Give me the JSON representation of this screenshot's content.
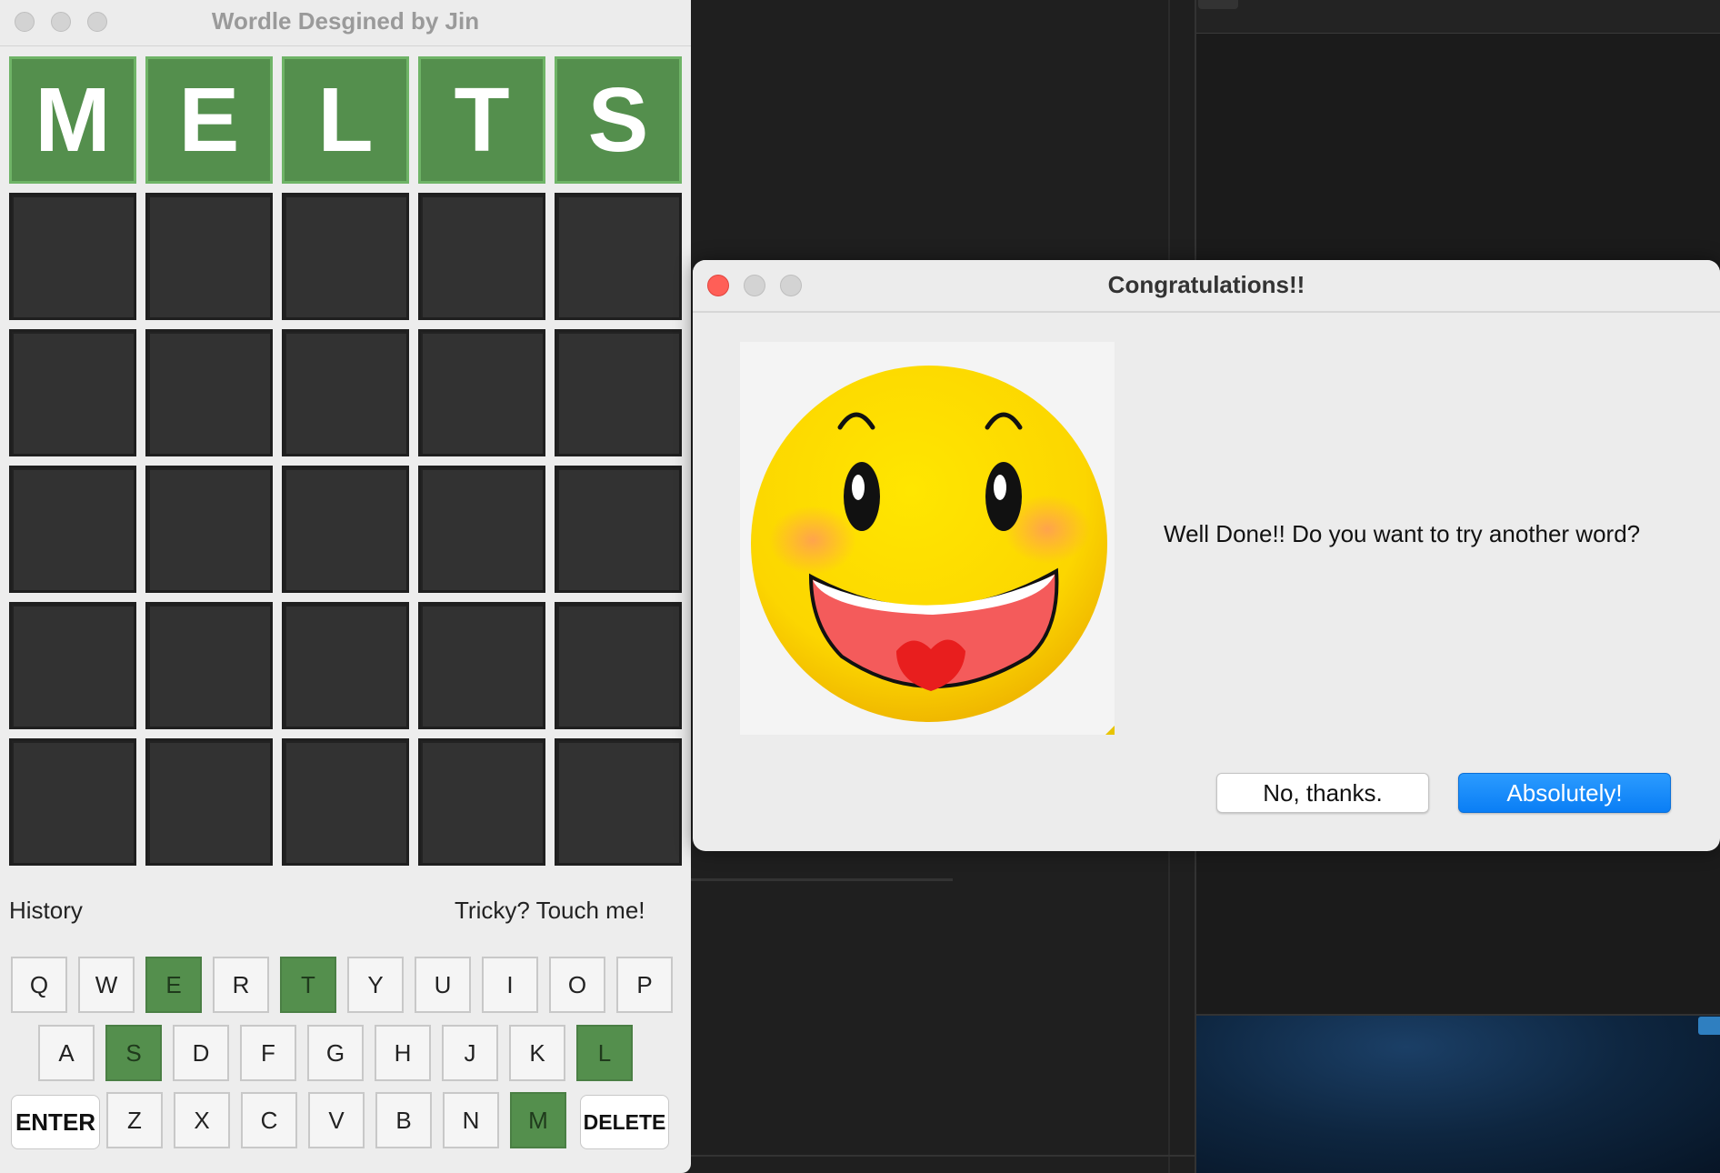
{
  "wordle": {
    "window_title": "Wordle Desgined by Jin",
    "guess_rows": [
      [
        "M",
        "E",
        "L",
        "T",
        "S"
      ],
      [
        "",
        "",
        "",
        "",
        ""
      ],
      [
        "",
        "",
        "",
        "",
        ""
      ],
      [
        "",
        "",
        "",
        "",
        ""
      ],
      [
        "",
        "",
        "",
        "",
        ""
      ],
      [
        "",
        "",
        "",
        "",
        ""
      ]
    ],
    "row_states": [
      "green",
      "empty",
      "empty",
      "empty",
      "empty",
      "empty"
    ],
    "history_label": "History",
    "hint_label": "Tricky? Touch me!",
    "keyboard": {
      "row1": [
        {
          "key": "Q",
          "state": "default"
        },
        {
          "key": "W",
          "state": "default"
        },
        {
          "key": "E",
          "state": "green"
        },
        {
          "key": "R",
          "state": "default"
        },
        {
          "key": "T",
          "state": "green"
        },
        {
          "key": "Y",
          "state": "default"
        },
        {
          "key": "U",
          "state": "default"
        },
        {
          "key": "I",
          "state": "default"
        },
        {
          "key": "O",
          "state": "default"
        },
        {
          "key": "P",
          "state": "default"
        }
      ],
      "row2": [
        {
          "key": "A",
          "state": "default"
        },
        {
          "key": "S",
          "state": "green"
        },
        {
          "key": "D",
          "state": "default"
        },
        {
          "key": "F",
          "state": "default"
        },
        {
          "key": "G",
          "state": "default"
        },
        {
          "key": "H",
          "state": "default"
        },
        {
          "key": "J",
          "state": "default"
        },
        {
          "key": "K",
          "state": "default"
        },
        {
          "key": "L",
          "state": "green"
        }
      ],
      "row3": [
        {
          "key": "Z",
          "state": "default"
        },
        {
          "key": "X",
          "state": "default"
        },
        {
          "key": "C",
          "state": "default"
        },
        {
          "key": "V",
          "state": "default"
        },
        {
          "key": "B",
          "state": "default"
        },
        {
          "key": "N",
          "state": "default"
        },
        {
          "key": "M",
          "state": "green"
        }
      ],
      "enter_label": "ENTER",
      "delete_label": "DELETE"
    },
    "colors": {
      "correct": "#548f4d",
      "empty_tile": "#323232",
      "key_default": "#f5f5f5"
    }
  },
  "dialog": {
    "title": "Congratulations!!",
    "message": "Well Done!! Do you want to try another word?",
    "image_icon": "smiley-face-icon",
    "decline_label": "No, thanks.",
    "accept_label": "Absolutely!",
    "colors": {
      "close": "#ff5f57",
      "primary": "#0a7ef5"
    }
  }
}
